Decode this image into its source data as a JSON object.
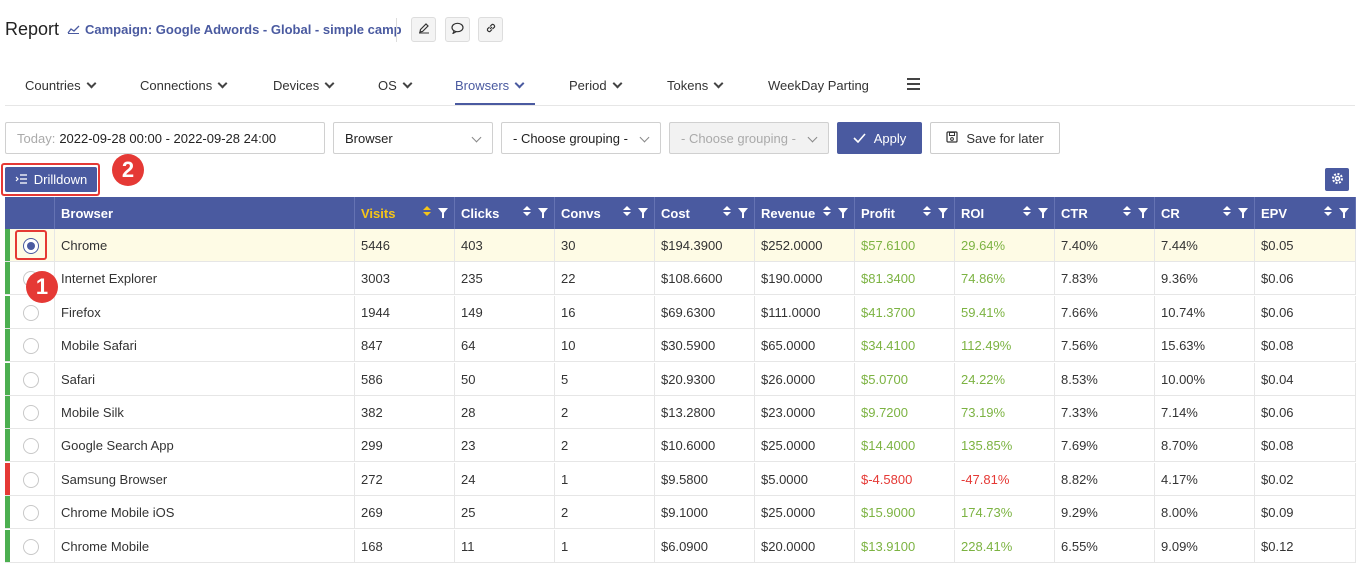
{
  "header": {
    "title": "Report",
    "campaign": "Campaign: Google Adwords - Global - simple camp"
  },
  "tabs": [
    {
      "label": "Countries",
      "has_chevron": true
    },
    {
      "label": "Connections",
      "has_chevron": true
    },
    {
      "label": "Devices",
      "has_chevron": true
    },
    {
      "label": "OS",
      "has_chevron": true
    },
    {
      "label": "Browsers",
      "has_chevron": true,
      "active": true
    },
    {
      "label": "Period",
      "has_chevron": true
    },
    {
      "label": "Tokens",
      "has_chevron": true
    },
    {
      "label": "WeekDay Parting",
      "has_chevron": false
    }
  ],
  "filters": {
    "date_prefix": "Today:",
    "date_value": "2022-09-28 00:00 - 2022-09-28 24:00",
    "group1": "Browser",
    "group2": "- Choose grouping -",
    "group3": "- Choose grouping -",
    "apply_label": "Apply",
    "save_label": "Save for later"
  },
  "drilldown_label": "Drilldown",
  "annotations": {
    "badge1": "1",
    "badge2": "2"
  },
  "table": {
    "columns": [
      "Browser",
      "Visits",
      "Clicks",
      "Convs",
      "Cost",
      "Revenue",
      "Profit",
      "ROI",
      "CTR",
      "CR",
      "EPV"
    ],
    "sorted_column": "Visits",
    "rows": [
      {
        "browser": "Chrome",
        "visits": "5446",
        "clicks": "403",
        "convs": "30",
        "cost": "$194.3900",
        "revenue": "$252.0000",
        "profit": "$57.6100",
        "roi": "29.64%",
        "ctr": "7.40%",
        "cr": "7.44%",
        "epv": "$0.05",
        "status": "positive",
        "selected": true
      },
      {
        "browser": "Internet Explorer",
        "visits": "3003",
        "clicks": "235",
        "convs": "22",
        "cost": "$108.6600",
        "revenue": "$190.0000",
        "profit": "$81.3400",
        "roi": "74.86%",
        "ctr": "7.83%",
        "cr": "9.36%",
        "epv": "$0.06",
        "status": "positive"
      },
      {
        "browser": "Firefox",
        "visits": "1944",
        "clicks": "149",
        "convs": "16",
        "cost": "$69.6300",
        "revenue": "$111.0000",
        "profit": "$41.3700",
        "roi": "59.41%",
        "ctr": "7.66%",
        "cr": "10.74%",
        "epv": "$0.06",
        "status": "positive"
      },
      {
        "browser": "Mobile Safari",
        "visits": "847",
        "clicks": "64",
        "convs": "10",
        "cost": "$30.5900",
        "revenue": "$65.0000",
        "profit": "$34.4100",
        "roi": "112.49%",
        "ctr": "7.56%",
        "cr": "15.63%",
        "epv": "$0.08",
        "status": "positive"
      },
      {
        "browser": "Safari",
        "visits": "586",
        "clicks": "50",
        "convs": "5",
        "cost": "$20.9300",
        "revenue": "$26.0000",
        "profit": "$5.0700",
        "roi": "24.22%",
        "ctr": "8.53%",
        "cr": "10.00%",
        "epv": "$0.04",
        "status": "positive"
      },
      {
        "browser": "Mobile Silk",
        "visits": "382",
        "clicks": "28",
        "convs": "2",
        "cost": "$13.2800",
        "revenue": "$23.0000",
        "profit": "$9.7200",
        "roi": "73.19%",
        "ctr": "7.33%",
        "cr": "7.14%",
        "epv": "$0.06",
        "status": "positive"
      },
      {
        "browser": "Google Search App",
        "visits": "299",
        "clicks": "23",
        "convs": "2",
        "cost": "$10.6000",
        "revenue": "$25.0000",
        "profit": "$14.4000",
        "roi": "135.85%",
        "ctr": "7.69%",
        "cr": "8.70%",
        "epv": "$0.08",
        "status": "positive"
      },
      {
        "browser": "Samsung Browser",
        "visits": "272",
        "clicks": "24",
        "convs": "1",
        "cost": "$9.5800",
        "revenue": "$5.0000",
        "profit": "$-4.5800",
        "roi": "-47.81%",
        "ctr": "8.82%",
        "cr": "4.17%",
        "epv": "$0.02",
        "status": "negative"
      },
      {
        "browser": "Chrome Mobile iOS",
        "visits": "269",
        "clicks": "25",
        "convs": "2",
        "cost": "$9.1000",
        "revenue": "$25.0000",
        "profit": "$15.9000",
        "roi": "174.73%",
        "ctr": "9.29%",
        "cr": "8.00%",
        "epv": "$0.09",
        "status": "positive"
      },
      {
        "browser": "Chrome Mobile",
        "visits": "168",
        "clicks": "11",
        "convs": "1",
        "cost": "$6.0900",
        "revenue": "$20.0000",
        "profit": "$13.9100",
        "roi": "228.41%",
        "ctr": "6.55%",
        "cr": "9.09%",
        "epv": "$0.12",
        "status": "positive"
      }
    ]
  },
  "colors": {
    "accent": "#4a5aa0",
    "positive": "#7cb342",
    "negative": "#e53935",
    "sorted_header": "#f5c518",
    "selected_row": "#fefbe5"
  }
}
